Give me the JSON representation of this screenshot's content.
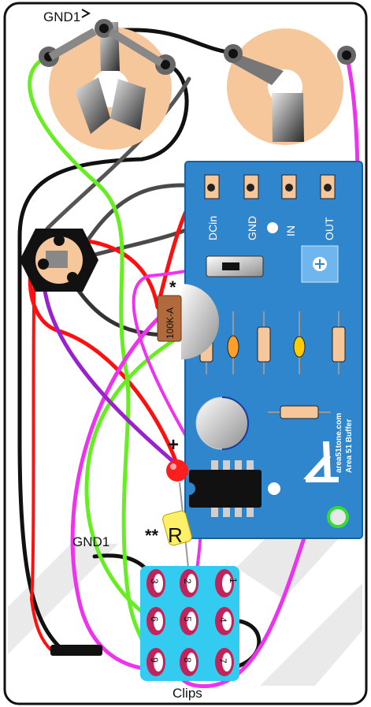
{
  "labels": {
    "gnd1_top": "GND1",
    "gnd1_bottom": "GND1",
    "clips": "Clips",
    "pot_value": "100K-A",
    "pot_mark": "*",
    "resistor_letter": "R",
    "resistor_mark": "**",
    "led_plus": "+",
    "pcb_pads": [
      "DCin",
      "GND",
      "IN",
      "OUT"
    ],
    "brand_line1": "area51tone.com",
    "brand_line2": "Area 51 Buffer",
    "clip_numbers": [
      "1",
      "2",
      "3",
      "4",
      "5",
      "6",
      "7",
      "8",
      "9"
    ]
  },
  "colors": {
    "board": "#2f86cc",
    "jack_disc": "#f6c79b",
    "clip_board": "#33ccf0",
    "clip_pad": "#c0245a",
    "wire_red": "#ff1010",
    "wire_black": "#111111",
    "wire_grey": "#4a4a4a",
    "wire_green": "#66ee22",
    "wire_magenta": "#ee33ee",
    "wire_purple": "#9922cc"
  }
}
